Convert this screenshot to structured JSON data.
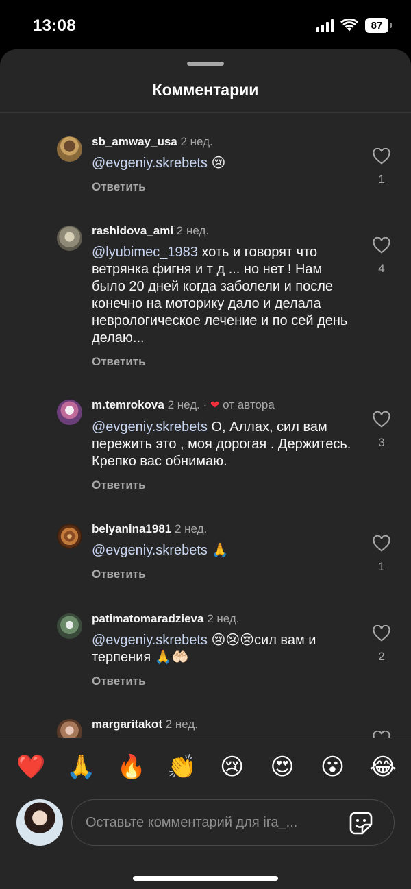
{
  "status_bar": {
    "time": "13:08",
    "battery": "87"
  },
  "sheet": {
    "title": "Комментарии"
  },
  "comments": [
    {
      "username": "sb_amway_usa",
      "time": "2 нед.",
      "mention": "@evgeniy.skrebets",
      "text": "😢",
      "reply_label": "Ответить",
      "likes": "1"
    },
    {
      "username": "rashidova_ami",
      "time": "2 нед.",
      "mention": "@lyubimec_1983",
      "text": "хоть и говорят что ветрянка фигня и т д ... но нет ! Нам было 20 дней когда заболели и после конечно на моторику дало и делала неврологическое лечение и по сей день делаю...",
      "reply_label": "Ответить",
      "likes": "4"
    },
    {
      "username": "m.temrokova",
      "time": "2 нед.",
      "separator": "·",
      "author_heart": "❤",
      "author_label": "от автора",
      "mention": "@evgeniy.skrebets",
      "text": "О, Аллах, сил вам пережить это , моя дорогая . Держитесь.  Крепко вас обнимаю.",
      "reply_label": "Ответить",
      "likes": "3"
    },
    {
      "username": "belyanina1981",
      "time": "2 нед.",
      "mention": "@evgeniy.skrebets",
      "text": "🙏",
      "reply_label": "Ответить",
      "likes": "1"
    },
    {
      "username": "patimatomaradzieva",
      "time": "2 нед.",
      "mention": "@evgeniy.skrebets",
      "text": "😢😢😢сил вам и терпения 🙏🤲🏻",
      "reply_label": "Ответить",
      "likes": "2"
    },
    {
      "username": "margaritakot",
      "time": "2 нед."
    }
  ],
  "reactions": [
    "❤️",
    "🙏",
    "🔥",
    "👏",
    "😢",
    "😍",
    "😮",
    "😂"
  ],
  "composer": {
    "placeholder": "Оставьте комментарий для ira_..."
  },
  "icons": {
    "like": "heart-outline-icon",
    "sticker": "sticker-icon",
    "signal": "cellular-signal-icon",
    "wifi": "wifi-icon",
    "battery": "battery-icon"
  },
  "colors": {
    "background": "#262626",
    "mention": "#c9d6f2",
    "secondary_text": "#a8a8a8",
    "author_heart": "#ff3040"
  }
}
